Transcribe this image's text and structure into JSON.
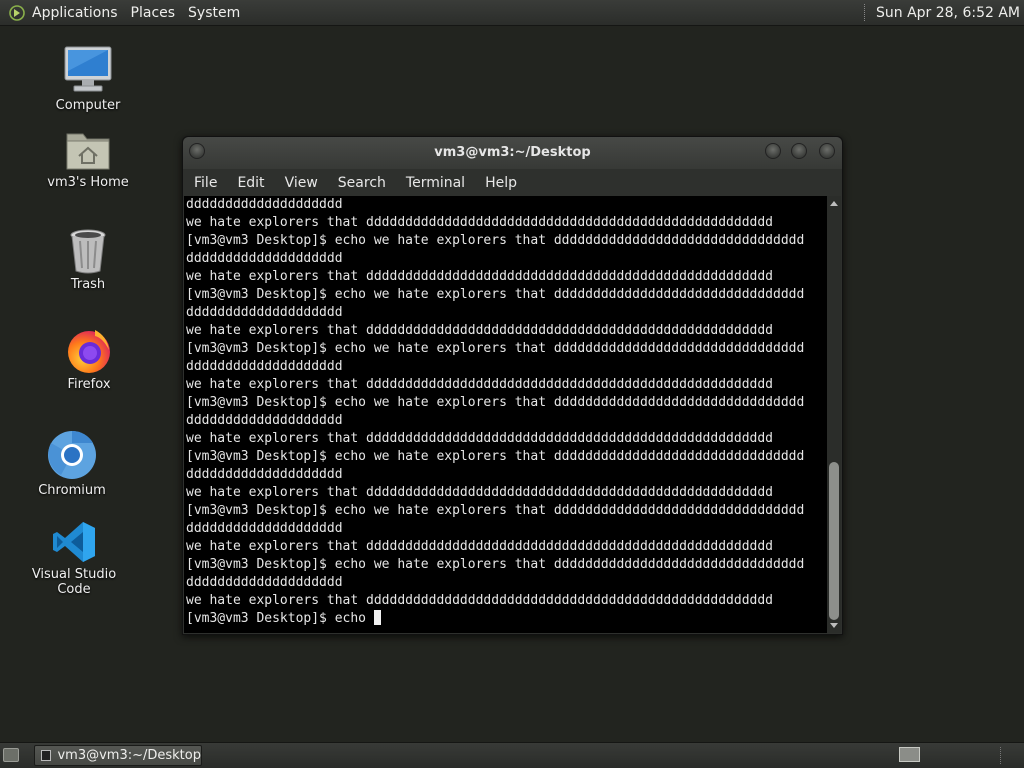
{
  "top_panel": {
    "menus": [
      "Applications",
      "Places",
      "System"
    ],
    "clock": "Sun Apr 28,  6:52 AM"
  },
  "desktop_icons": [
    {
      "label": "Computer",
      "icon": "computer-icon"
    },
    {
      "label": "vm3's Home",
      "icon": "home-folder-icon"
    },
    {
      "label": "Trash",
      "icon": "trash-icon"
    },
    {
      "label": "Firefox",
      "icon": "firefox-icon"
    },
    {
      "label": "Chromium",
      "icon": "chromium-icon"
    },
    {
      "label": "Visual Studio Code",
      "icon": "vscode-icon"
    }
  ],
  "terminal": {
    "title": "vm3@vm3:~/Desktop",
    "menu": [
      "File",
      "Edit",
      "View",
      "Search",
      "Terminal",
      "Help"
    ],
    "lines": [
      "dddddddddddddddddddd",
      "we hate explorers that dddddddddddddddddddddddddddddddddddddddddddddddddddd",
      "[vm3@vm3 Desktop]$ echo we hate explorers that dddddddddddddddddddddddddddddddd",
      "dddddddddddddddddddd",
      "we hate explorers that dddddddddddddddddddddddddddddddddddddddddddddddddddd",
      "[vm3@vm3 Desktop]$ echo we hate explorers that dddddddddddddddddddddddddddddddd",
      "dddddddddddddddddddd",
      "we hate explorers that dddddddddddddddddddddddddddddddddddddddddddddddddddd",
      "[vm3@vm3 Desktop]$ echo we hate explorers that dddddddddddddddddddddddddddddddd",
      "dddddddddddddddddddd",
      "we hate explorers that dddddddddddddddddddddddddddddddddddddddddddddddddddd",
      "[vm3@vm3 Desktop]$ echo we hate explorers that dddddddddddddddddddddddddddddddd",
      "dddddddddddddddddddd",
      "we hate explorers that dddddddddddddddddddddddddddddddddddddddddddddddddddd",
      "[vm3@vm3 Desktop]$ echo we hate explorers that dddddddddddddddddddddddddddddddd",
      "dddddddddddddddddddd",
      "we hate explorers that dddddddddddddddddddddddddddddddddddddddddddddddddddd",
      "[vm3@vm3 Desktop]$ echo we hate explorers that dddddddddddddddddddddddddddddddd",
      "dddddddddddddddddddd",
      "we hate explorers that dddddddddddddddddddddddddddddddddddddddddddddddddddd",
      "[vm3@vm3 Desktop]$ echo we hate explorers that dddddddddddddddddddddddddddddddd",
      "dddddddddddddddddddd",
      "we hate explorers that dddddddddddddddddddddddddddddddddddddddddddddddddddd"
    ],
    "prompt_line": "[vm3@vm3 Desktop]$ echo "
  },
  "bottom_panel": {
    "task_label": "vm3@vm3:~/Desktop"
  },
  "colors": {
    "desktop_bg": "#22241f",
    "panel_bg": "#2e302d",
    "terminal_bg": "#000000",
    "terminal_fg": "#e6e6e6"
  }
}
